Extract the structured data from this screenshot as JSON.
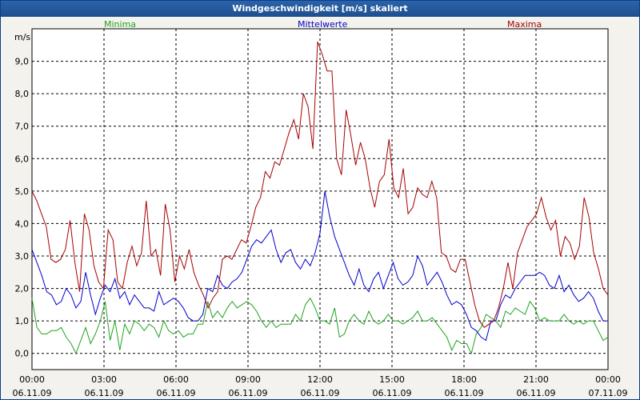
{
  "window": {
    "title": "Windgeschwindigkeit [m/s] skaliert"
  },
  "colors": {
    "minima": "#1fa31f",
    "mittel": "#0000cc",
    "maxima": "#a50000",
    "grid": "#000000"
  },
  "chart_data": {
    "type": "line",
    "title": "Windgeschwindigkeit [m/s] skaliert",
    "ylabel": "m/s",
    "xlabel": "",
    "ylim": [
      -0.5,
      10.0
    ],
    "xlim_hours": [
      0,
      24
    ],
    "y_ticks": [
      "0,0",
      "1,0",
      "2,0",
      "3,0",
      "4,0",
      "5,0",
      "6,0",
      "7,0",
      "8,0",
      "9,0"
    ],
    "x_ticks": [
      {
        "time": "00:00",
        "date": "06.11.09"
      },
      {
        "time": "03:00",
        "date": "06.11.09"
      },
      {
        "time": "06:00",
        "date": "06.11.09"
      },
      {
        "time": "09:00",
        "date": "06.11.09"
      },
      {
        "time": "12:00",
        "date": "06.11.09"
      },
      {
        "time": "15:00",
        "date": "06.11.09"
      },
      {
        "time": "18:00",
        "date": "06.11.09"
      },
      {
        "time": "21:00",
        "date": "06.11.09"
      },
      {
        "time": "00:00",
        "date": "07.11.09"
      }
    ],
    "grid": true,
    "legend_position": "top",
    "series": [
      {
        "name": "Minima",
        "color": "#1fa31f",
        "values": [
          1.7,
          0.8,
          0.6,
          0.6,
          0.7,
          0.7,
          0.8,
          0.5,
          0.3,
          0.0,
          0.4,
          0.8,
          0.3,
          0.6,
          1.0,
          1.6,
          0.4,
          1.0,
          0.1,
          0.9,
          0.6,
          1.0,
          0.9,
          0.7,
          0.9,
          0.8,
          0.5,
          1.0,
          0.7,
          0.6,
          0.7,
          0.5,
          0.6,
          0.6,
          0.9,
          0.9,
          1.6,
          1.1,
          1.3,
          1.1,
          1.4,
          1.6,
          1.4,
          1.5,
          1.6,
          1.5,
          1.3,
          1.0,
          0.8,
          1.0,
          0.8,
          0.9,
          0.9,
          0.9,
          1.2,
          1.0,
          1.5,
          1.7,
          1.4,
          1.0,
          1.0,
          0.9,
          1.4,
          0.5,
          0.6,
          1.0,
          1.2,
          1.0,
          0.9,
          1.3,
          1.0,
          0.9,
          1.0,
          1.2,
          1.0,
          1.0,
          0.9,
          1.0,
          1.1,
          1.3,
          1.0,
          1.0,
          1.1,
          0.9,
          0.7,
          0.5,
          0.1,
          0.4,
          0.3,
          0.3,
          0.0,
          0.6,
          0.8,
          1.2,
          1.1,
          1.0,
          0.8,
          1.3,
          1.2,
          1.4,
          1.3,
          1.2,
          1.6,
          1.4,
          1.0,
          1.1,
          1.0,
          1.0,
          1.0,
          1.2,
          1.0,
          0.9,
          1.0,
          0.9,
          1.0,
          1.0,
          0.7,
          0.4,
          0.5
        ]
      },
      {
        "name": "Mittelwerte",
        "color": "#0000cc",
        "values": [
          3.2,
          2.8,
          2.4,
          1.9,
          1.8,
          1.5,
          1.6,
          2.0,
          1.8,
          1.4,
          1.6,
          2.5,
          1.8,
          1.2,
          1.7,
          2.1,
          1.9,
          2.3,
          1.7,
          1.9,
          1.5,
          1.8,
          1.6,
          1.4,
          1.4,
          1.3,
          1.9,
          1.5,
          1.6,
          1.7,
          1.6,
          1.4,
          1.1,
          1.0,
          1.0,
          1.2,
          2.0,
          1.9,
          2.4,
          2.1,
          2.0,
          2.2,
          2.3,
          2.5,
          2.9,
          3.3,
          3.5,
          3.4,
          3.6,
          3.8,
          3.2,
          2.8,
          3.1,
          3.2,
          2.8,
          2.6,
          2.9,
          2.7,
          3.1,
          3.7,
          5.0,
          4.2,
          3.6,
          3.2,
          2.8,
          2.4,
          2.1,
          2.6,
          2.1,
          1.9,
          2.3,
          2.5,
          2.0,
          2.4,
          2.8,
          2.3,
          2.1,
          2.2,
          2.4,
          3.0,
          2.7,
          2.1,
          2.3,
          2.5,
          2.2,
          1.8,
          1.5,
          1.6,
          1.5,
          1.2,
          0.8,
          0.7,
          0.5,
          0.4,
          1.0,
          1.0,
          1.5,
          1.8,
          1.7,
          2.0,
          2.2,
          2.4,
          2.4,
          2.4,
          2.5,
          2.4,
          2.1,
          2.0,
          2.4,
          1.9,
          2.1,
          1.8,
          1.6,
          1.7,
          1.9,
          1.7,
          1.3,
          1.0,
          1.0
        ]
      },
      {
        "name": "Maxima",
        "color": "#a50000",
        "values": [
          5.0,
          4.7,
          4.3,
          3.9,
          2.9,
          2.8,
          2.9,
          3.2,
          4.1,
          2.8,
          1.9,
          4.3,
          3.8,
          2.7,
          2.2,
          2.0,
          3.8,
          3.5,
          2.2,
          2.0,
          2.8,
          3.3,
          2.7,
          3.1,
          4.7,
          3.0,
          3.2,
          2.4,
          4.6,
          3.8,
          2.2,
          3.0,
          2.6,
          3.2,
          2.5,
          2.1,
          1.8,
          1.4,
          1.7,
          1.9,
          2.9,
          3.0,
          2.9,
          3.2,
          3.5,
          3.4,
          3.9,
          4.5,
          4.8,
          5.6,
          5.4,
          5.9,
          5.8,
          6.3,
          6.8,
          7.2,
          6.6,
          8.0,
          7.6,
          6.3,
          9.6,
          9.2,
          8.7,
          8.7,
          6.0,
          5.5,
          7.5,
          6.7,
          5.8,
          6.5,
          6.0,
          5.1,
          4.5,
          5.3,
          5.5,
          6.6,
          5.1,
          4.8,
          5.7,
          4.3,
          4.5,
          5.1,
          4.9,
          4.8,
          5.3,
          4.8,
          3.1,
          3.0,
          2.6,
          2.5,
          2.9,
          2.9,
          2.2,
          1.5,
          1.0,
          0.8,
          0.9,
          1.0,
          1.4,
          2.0,
          2.8,
          2.0,
          3.1,
          3.5,
          3.9,
          4.1,
          4.3,
          4.8,
          4.2,
          3.8,
          4.1,
          3.0,
          3.6,
          3.4,
          2.9,
          3.3,
          4.8,
          4.2,
          3.1,
          2.6,
          2.0,
          1.8
        ]
      }
    ]
  }
}
